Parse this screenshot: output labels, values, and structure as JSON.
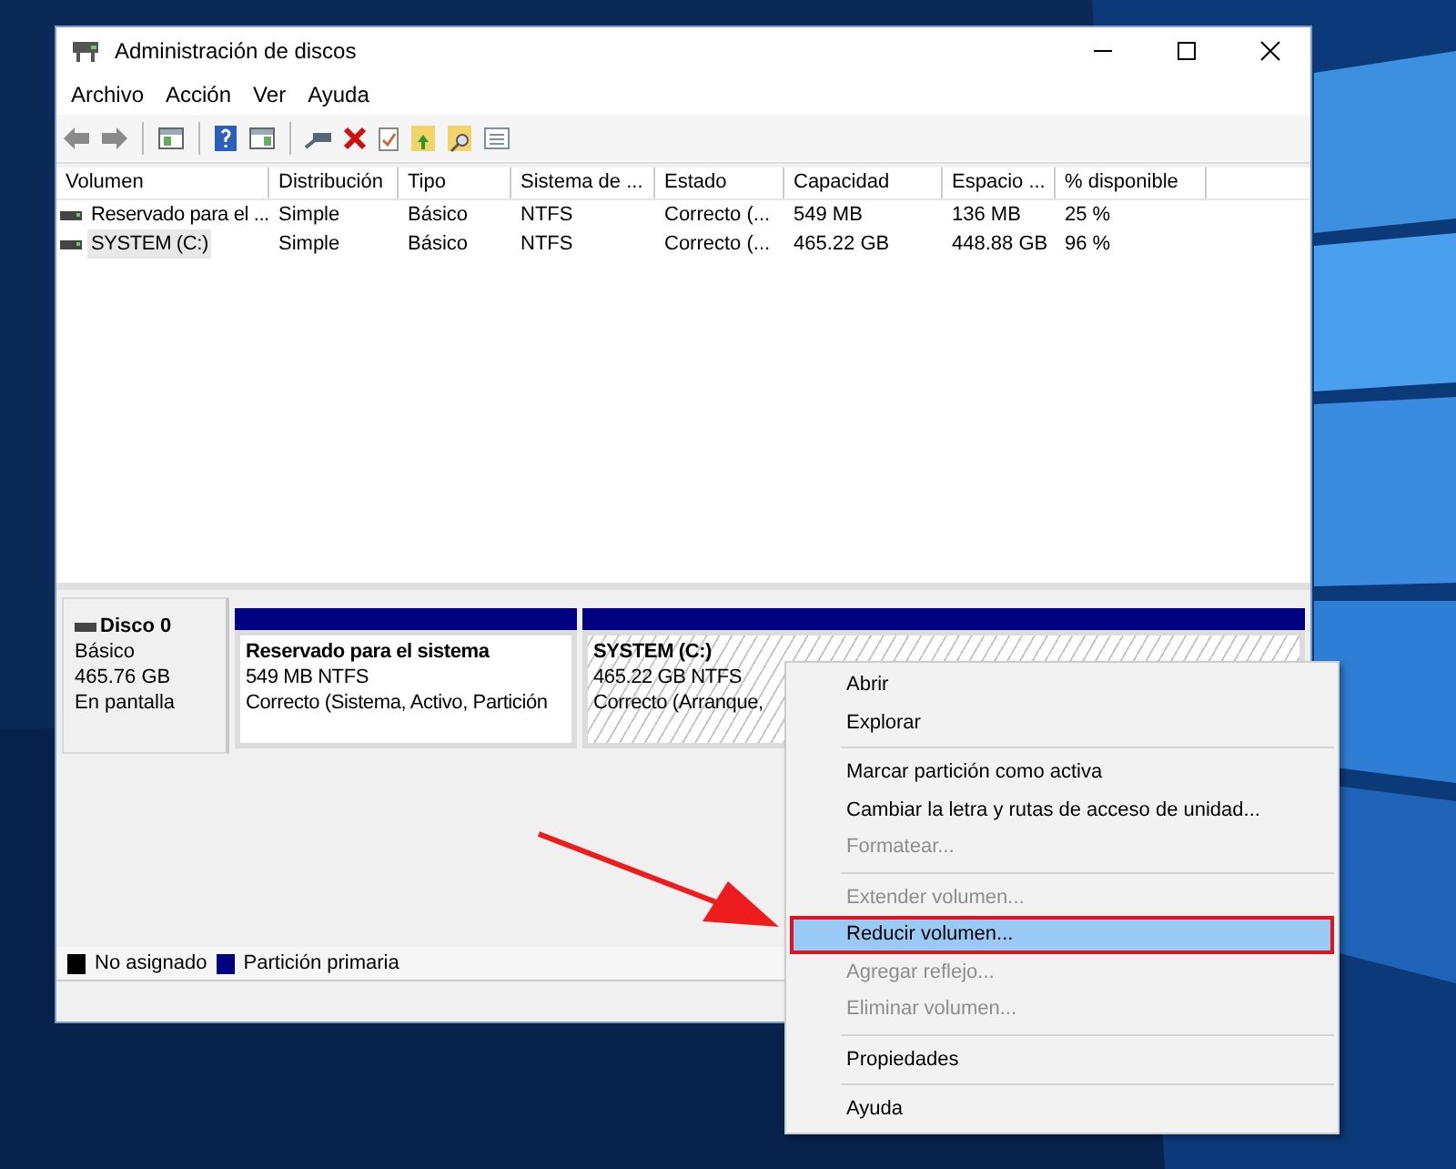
{
  "window": {
    "title": "Administración de discos"
  },
  "menu": [
    "Archivo",
    "Acción",
    "Ver",
    "Ayuda"
  ],
  "volumes_table": {
    "columns": [
      "Volumen",
      "Distribución",
      "Tipo",
      "Sistema de ...",
      "Estado",
      "Capacidad",
      "Espacio ...",
      "% disponible"
    ],
    "rows": [
      {
        "selected": false,
        "cells": [
          "Reservado para el ...",
          "Simple",
          "Básico",
          "NTFS",
          "Correcto (...",
          "549 MB",
          "136 MB",
          "25 %"
        ]
      },
      {
        "selected": true,
        "cells": [
          "SYSTEM (C:)",
          "Simple",
          "Básico",
          "NTFS",
          "Correcto (...",
          "465.22 GB",
          "448.88 GB",
          "96 %"
        ]
      }
    ]
  },
  "disk": {
    "name": "Disco 0",
    "type": "Básico",
    "size": "465.76 GB",
    "status": "En pantalla",
    "partitions": [
      {
        "name": "Reservado para el sistema",
        "size": "549 MB NTFS",
        "status": "Correcto (Sistema, Activo, Partición",
        "selected": false
      },
      {
        "name": "SYSTEM  (C:)",
        "size": "465.22 GB NTFS",
        "status": "Correcto (Arranque,",
        "selected": true
      }
    ]
  },
  "legend": [
    {
      "label": "No asignado",
      "color": "#000000"
    },
    {
      "label": "Partición primaria",
      "color": "#000080"
    }
  ],
  "context_menu": [
    [
      {
        "label": "Abrir",
        "disabled": false,
        "selected": false
      },
      {
        "label": "Explorar",
        "disabled": false,
        "selected": false
      }
    ],
    [
      {
        "label": "Marcar partición como activa",
        "disabled": false,
        "selected": false
      },
      {
        "label": "Cambiar la letra y rutas de acceso de unidad...",
        "disabled": false,
        "selected": false
      },
      {
        "label": "Formatear...",
        "disabled": true,
        "selected": false
      }
    ],
    [
      {
        "label": "Extender volumen...",
        "disabled": true,
        "selected": false
      },
      {
        "label": "Reducir volumen...",
        "disabled": false,
        "selected": true
      },
      {
        "label": "Agregar reflejo...",
        "disabled": true,
        "selected": false
      },
      {
        "label": "Eliminar volumen...",
        "disabled": true,
        "selected": false
      }
    ],
    [
      {
        "label": "Propiedades",
        "disabled": false,
        "selected": false
      }
    ],
    [
      {
        "label": "Ayuda",
        "disabled": false,
        "selected": false
      }
    ]
  ]
}
